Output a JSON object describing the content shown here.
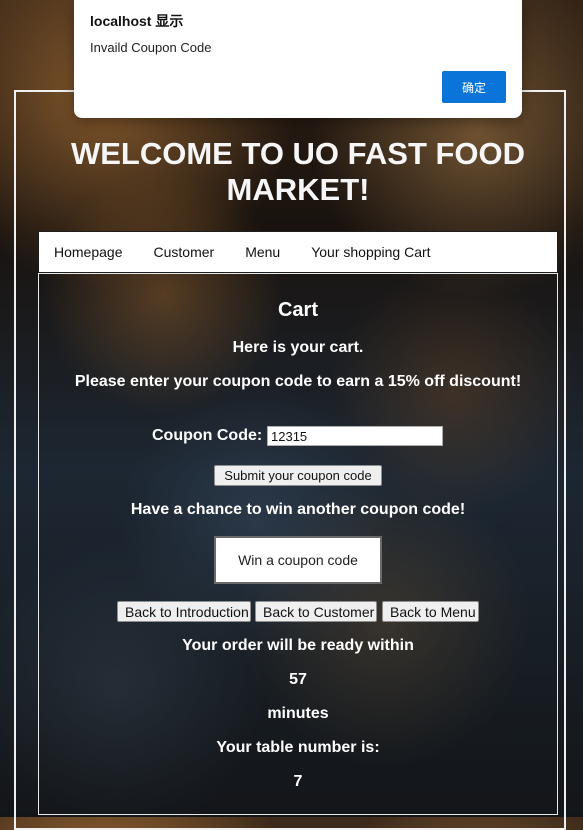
{
  "alert": {
    "title": "localhost 显示",
    "message": "Invaild Coupon Code",
    "ok_label": "确定"
  },
  "header": {
    "title": "WELCOME TO UO FAST FOOD MARKET!"
  },
  "nav": {
    "items": [
      {
        "label": "Homepage"
      },
      {
        "label": "Customer"
      },
      {
        "label": "Menu"
      },
      {
        "label": "Your shopping Cart"
      }
    ]
  },
  "cart": {
    "heading": "Cart",
    "intro": "Here is your cart.",
    "discount_prompt": "Please enter your coupon code to earn a 15% off discount!",
    "coupon_label": "Coupon Code:",
    "coupon_value": "12315",
    "submit_label": "Submit your coupon code",
    "chance_text": "Have a chance to win another coupon code!",
    "win_label": "Win a coupon code",
    "back_intro_label": "Back to Introduction",
    "back_customer_label": "Back to Customer",
    "back_menu_label": "Back to Menu",
    "ready_text": "Your order will be ready within",
    "minutes_value": "57",
    "minutes_label": "minutes",
    "table_text": "Your table number is:",
    "table_number": "7"
  }
}
